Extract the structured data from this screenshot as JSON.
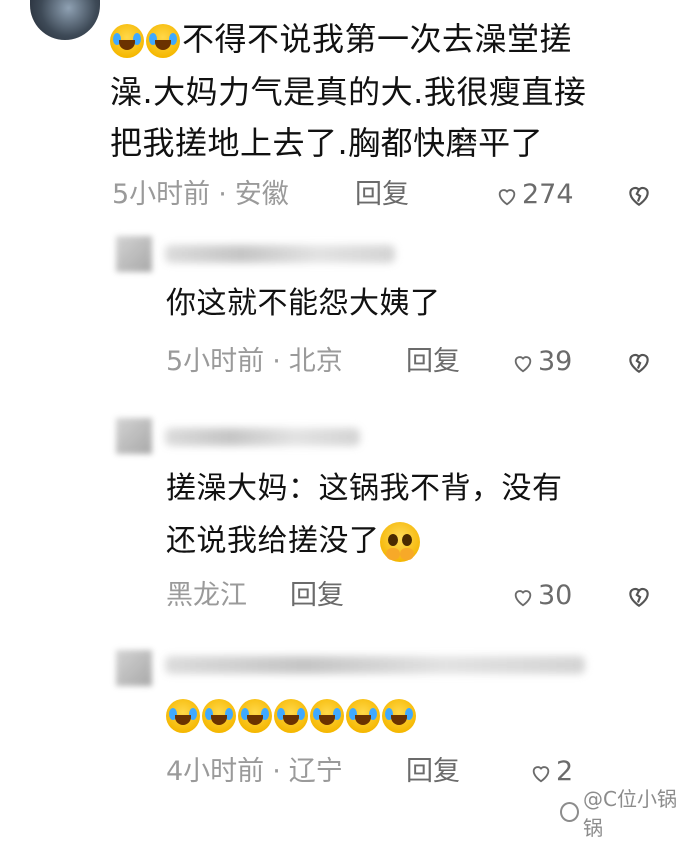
{
  "comments": [
    {
      "text_lines": [
        "不得不说我第一次去澡堂搓",
        "澡.大妈力气是真的大.我很瘦直接",
        "把我搓地上去了.胸都快磨平了"
      ],
      "time": "5小时前",
      "location": "安徽",
      "reply_label": "回复",
      "likes": "274"
    },
    {
      "text_lines": [
        "你这就不能怨大姨了"
      ],
      "time": "5小时前",
      "location": "北京",
      "reply_label": "回复",
      "likes": "39"
    },
    {
      "text_lines": [
        "搓澡大妈：这锅我不背，没有",
        "还说我给搓没了"
      ],
      "time": "",
      "location": "黑龙江",
      "reply_label": "回复",
      "likes": "30"
    },
    {
      "text_lines": [
        ""
      ],
      "time": "4小时前",
      "location": "辽宁",
      "reply_label": "回复",
      "likes": "2"
    }
  ],
  "watermark": "@C位小锅锅",
  "icons": {
    "laugh_cry": "face-with-tears-of-joy-icon",
    "pleading": "pleading-face-icon",
    "like": "heart-outline-icon",
    "dislike": "broken-heart-icon"
  },
  "colors": {
    "text": "#111111",
    "meta": "#9a9a9a",
    "secondary": "#6b6b6b",
    "background": "#ffffff"
  }
}
